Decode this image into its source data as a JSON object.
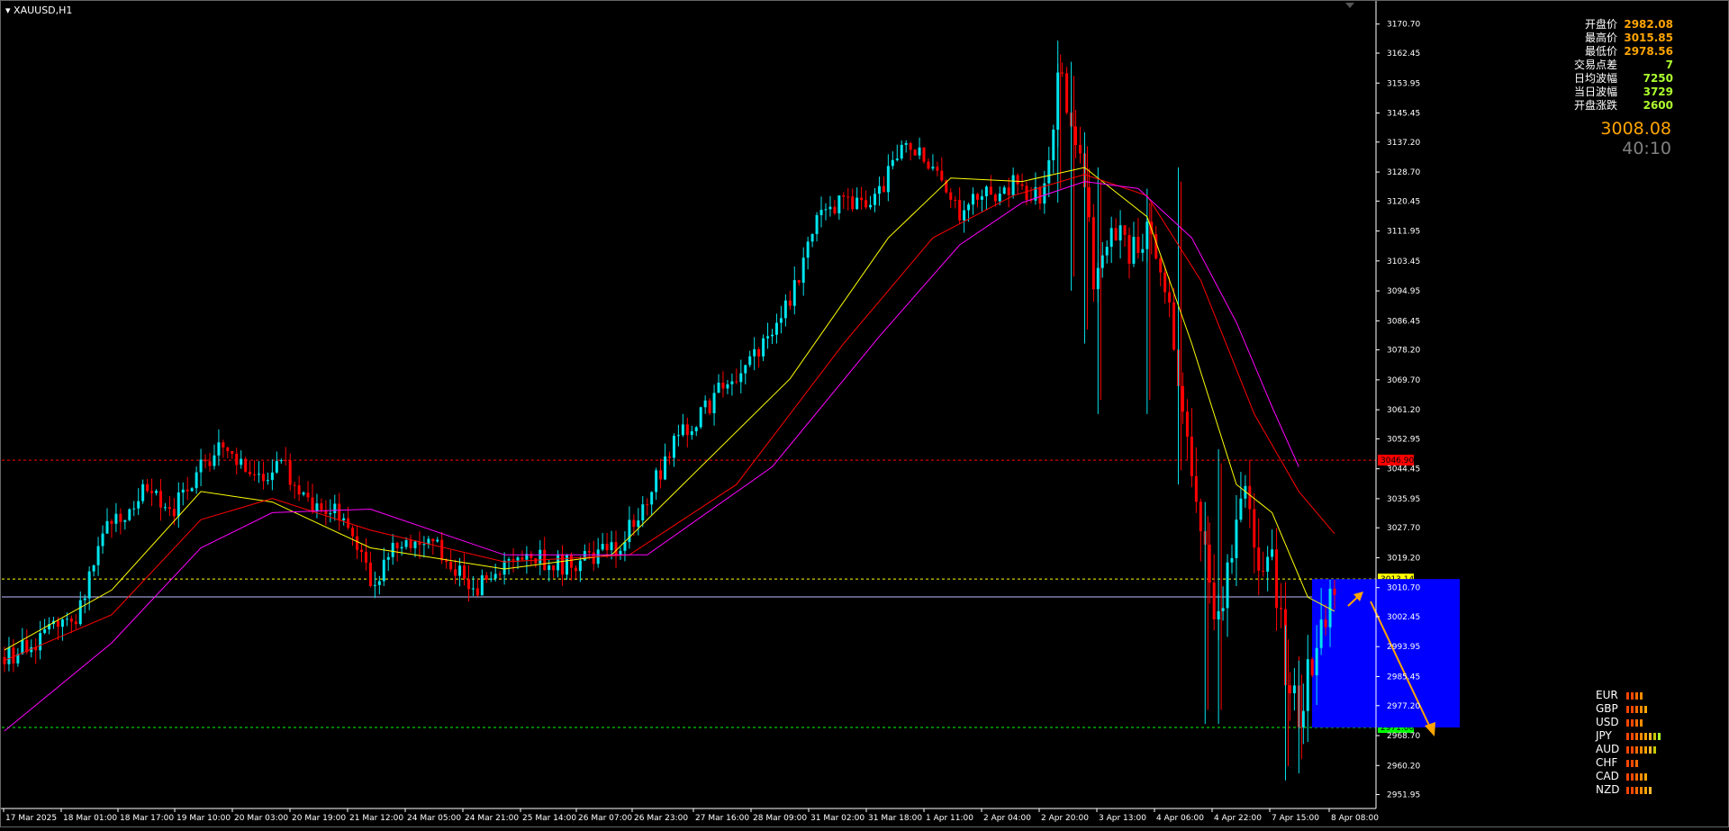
{
  "window": {
    "title": "XAUUSD,H1"
  },
  "info_panel": {
    "rows": [
      {
        "label": "开盘价",
        "value": "2982.08",
        "color": "#ffa500"
      },
      {
        "label": "最高价",
        "value": "3015.85",
        "color": "#ffa500"
      },
      {
        "label": "最低价",
        "value": "2978.56",
        "color": "#ffa500"
      },
      {
        "label": "交易点差",
        "value": "7",
        "color": "#adff2f"
      },
      {
        "label": "日均波幅",
        "value": "7250",
        "color": "#adff2f"
      },
      {
        "label": "当日波幅",
        "value": "3729",
        "color": "#adff2f"
      },
      {
        "label": "开盘涨跌",
        "value": "2600",
        "color": "#adff2f"
      }
    ],
    "current_price": "3008.08",
    "countdown": "40:10"
  },
  "price_axis": {
    "ticks": [
      "3170.70",
      "3162.45",
      "3153.95",
      "3145.45",
      "3137.20",
      "3128.70",
      "3120.45",
      "3111.95",
      "3103.45",
      "3094.95",
      "3086.45",
      "3078.20",
      "3069.70",
      "3061.20",
      "3052.95",
      "3044.45",
      "3035.95",
      "3027.70",
      "3019.20",
      "3010.70",
      "3002.45",
      "2993.95",
      "2985.45",
      "2977.20",
      "2968.70",
      "2960.20",
      "2951.95"
    ],
    "labels": {
      "red_line": "3046.90",
      "yellow_line": "3013.14",
      "current": "3008.08",
      "green_line": "2971.00"
    }
  },
  "time_axis": {
    "labels": [
      "17 Mar 2025",
      "18 Mar 01:00",
      "18 Mar 17:00",
      "19 Mar 10:00",
      "20 Mar 03:00",
      "20 Mar 19:00",
      "21 Mar 12:00",
      "24 Mar 05:00",
      "24 Mar 21:00",
      "25 Mar 14:00",
      "26 Mar 07:00",
      "26 Mar 23:00",
      "27 Mar 16:00",
      "28 Mar 09:00",
      "31 Mar 02:00",
      "31 Mar 18:00",
      "1 Apr 11:00",
      "2 Apr 04:00",
      "2 Apr 20:00",
      "3 Apr 13:00",
      "4 Apr 06:00",
      "4 Apr 22:00",
      "7 Apr 15:00",
      "8 Apr 08:00"
    ]
  },
  "colors": {
    "bull": "#00e5ee",
    "bear": "#ff0000",
    "ma_fast": "#ffff00",
    "ma_mid": "#ff0000",
    "ma_slow": "#ff00ff",
    "zone": "#0000ff",
    "arrow": "#ffa500"
  },
  "currency_strength": [
    {
      "name": "EUR",
      "level": 4
    },
    {
      "name": "GBP",
      "level": 5
    },
    {
      "name": "USD",
      "level": 4
    },
    {
      "name": "JPY",
      "level": 8
    },
    {
      "name": "AUD",
      "level": 7
    },
    {
      "name": "CHF",
      "level": 3
    },
    {
      "name": "CAD",
      "level": 5
    },
    {
      "name": "NZD",
      "level": 6
    }
  ],
  "chart_data": {
    "type": "candlestick",
    "symbol": "XAUUSD",
    "timeframe": "H1",
    "ylim": [
      2948,
      3176
    ],
    "horizontal_levels": [
      {
        "price": 3046.9,
        "color": "#ff0000",
        "style": "dashed"
      },
      {
        "price": 3013.14,
        "color": "#ffff00",
        "style": "dashed"
      },
      {
        "price": 3008.08,
        "color": "#c0c0ff",
        "style": "solid"
      },
      {
        "price": 2971.0,
        "color": "#00ff00",
        "style": "dashed"
      }
    ],
    "zone": {
      "from_label": "7 Apr 15:00",
      "top": 3013.14,
      "bottom": 2971.0
    },
    "keypoints": [
      [
        0,
        2991
      ],
      [
        40,
        2996
      ],
      [
        80,
        3003
      ],
      [
        120,
        3030
      ],
      [
        160,
        3038
      ],
      [
        190,
        3034
      ],
      [
        220,
        3045
      ],
      [
        250,
        3051
      ],
      [
        270,
        3044
      ],
      [
        290,
        3040
      ],
      [
        310,
        3046
      ],
      [
        340,
        3035
      ],
      [
        370,
        3032
      ],
      [
        390,
        3027
      ],
      [
        410,
        3012
      ],
      [
        440,
        3022
      ],
      [
        470,
        3026
      ],
      [
        500,
        3017
      ],
      [
        530,
        3010
      ],
      [
        560,
        3016
      ],
      [
        590,
        3020
      ],
      [
        620,
        3017
      ],
      [
        650,
        3019
      ],
      [
        680,
        3021
      ],
      [
        710,
        3030
      ],
      [
        740,
        3047
      ],
      [
        770,
        3058
      ],
      [
        800,
        3066
      ],
      [
        830,
        3075
      ],
      [
        860,
        3082
      ],
      [
        880,
        3092
      ],
      [
        910,
        3116
      ],
      [
        940,
        3122
      ],
      [
        970,
        3117
      ],
      [
        990,
        3128
      ],
      [
        1010,
        3140
      ],
      [
        1030,
        3132
      ],
      [
        1050,
        3126
      ],
      [
        1070,
        3116
      ],
      [
        1090,
        3124
      ],
      [
        1110,
        3120
      ],
      [
        1130,
        3126
      ],
      [
        1150,
        3118
      ],
      [
        1170,
        3131
      ],
      [
        1180,
        3158
      ],
      [
        1195,
        3140
      ],
      [
        1210,
        3126
      ],
      [
        1220,
        3097
      ],
      [
        1240,
        3115
      ],
      [
        1260,
        3106
      ],
      [
        1280,
        3111
      ],
      [
        1300,
        3093
      ],
      [
        1315,
        3073
      ],
      [
        1330,
        3040
      ],
      [
        1345,
        3018
      ],
      [
        1360,
        3000
      ],
      [
        1375,
        3025
      ],
      [
        1390,
        3033
      ],
      [
        1405,
        3020
      ],
      [
        1420,
        3025
      ],
      [
        1435,
        2985
      ],
      [
        1450,
        2972
      ],
      [
        1465,
        2990
      ],
      [
        1480,
        3003
      ],
      [
        1490,
        3012
      ]
    ],
    "moving_averages": [
      {
        "color": "#ffff00",
        "points": [
          [
            0,
            2993
          ],
          [
            120,
            3010
          ],
          [
            220,
            3038
          ],
          [
            300,
            3035
          ],
          [
            410,
            3022
          ],
          [
            560,
            3016
          ],
          [
            680,
            3020
          ],
          [
            760,
            3040
          ],
          [
            880,
            3070
          ],
          [
            990,
            3110
          ],
          [
            1060,
            3127
          ],
          [
            1140,
            3126
          ],
          [
            1210,
            3130
          ],
          [
            1280,
            3116
          ],
          [
            1330,
            3080
          ],
          [
            1380,
            3040
          ],
          [
            1420,
            3032
          ],
          [
            1460,
            3008
          ],
          [
            1490,
            3004
          ]
        ]
      },
      {
        "color": "#ff0000",
        "points": [
          [
            0,
            2990
          ],
          [
            120,
            3003
          ],
          [
            220,
            3030
          ],
          [
            300,
            3036
          ],
          [
            410,
            3027
          ],
          [
            560,
            3018
          ],
          [
            700,
            3020
          ],
          [
            820,
            3040
          ],
          [
            940,
            3080
          ],
          [
            1040,
            3110
          ],
          [
            1130,
            3122
          ],
          [
            1210,
            3128
          ],
          [
            1280,
            3122
          ],
          [
            1340,
            3098
          ],
          [
            1400,
            3060
          ],
          [
            1450,
            3038
          ],
          [
            1490,
            3026
          ]
        ]
      },
      {
        "color": "#ff00ff",
        "points": [
          [
            0,
            2970
          ],
          [
            120,
            2995
          ],
          [
            220,
            3022
          ],
          [
            300,
            3032
          ],
          [
            410,
            3033
          ],
          [
            560,
            3020
          ],
          [
            720,
            3020
          ],
          [
            860,
            3045
          ],
          [
            980,
            3082
          ],
          [
            1070,
            3108
          ],
          [
            1140,
            3120
          ],
          [
            1210,
            3126
          ],
          [
            1270,
            3124
          ],
          [
            1330,
            3110
          ],
          [
            1380,
            3086
          ],
          [
            1420,
            3062
          ],
          [
            1450,
            3045
          ]
        ]
      }
    ]
  }
}
